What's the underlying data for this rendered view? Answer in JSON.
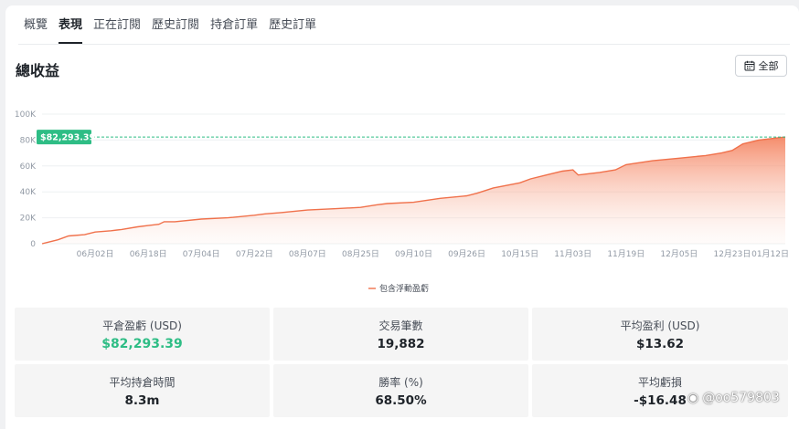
{
  "tabs": [
    {
      "label": "概覽",
      "active": false
    },
    {
      "label": "表現",
      "active": true
    },
    {
      "label": "正在訂閱",
      "active": false
    },
    {
      "label": "歷史訂閱",
      "active": false
    },
    {
      "label": "持倉訂單",
      "active": false
    },
    {
      "label": "歷史訂單",
      "active": false
    }
  ],
  "section": {
    "title": "總收益",
    "range_label": "全部"
  },
  "colors": {
    "line": "#f0714b",
    "fill_top": "#f4805c",
    "badge": "#2ebd85",
    "reference_line": "#2ebd85",
    "green_value": "#2ebd85"
  },
  "chart_data": {
    "type": "area",
    "title": "",
    "xlabel": "",
    "ylabel": "",
    "ylim": [
      0,
      100000
    ],
    "y_ticks": [
      0,
      20000,
      40000,
      60000,
      80000,
      100000
    ],
    "y_tick_labels": [
      "0",
      "20K",
      "40K",
      "60K",
      "80K",
      "100K"
    ],
    "x_tick_labels": [
      "06月02日",
      "06月18日",
      "07月04日",
      "07月22日",
      "08月07日",
      "08月25日",
      "09月10日",
      "09月26日",
      "10月15日",
      "11月03日",
      "11月19日",
      "12月05日",
      "12月23日",
      "01月12日"
    ],
    "x_tick_positions": [
      1.0,
      2.0,
      3.0,
      4.0,
      5.0,
      6.0,
      7.0,
      8.0,
      9.0,
      10.0,
      11.0,
      12.0,
      13.0,
      14.0
    ],
    "grid": true,
    "legend_position": "bottom-center",
    "series": [
      {
        "name": "包含浮動盈虧",
        "x": [
          0.0,
          0.1,
          0.3,
          0.5,
          0.8,
          1.0,
          1.3,
          1.5,
          1.8,
          2.0,
          2.2,
          2.3,
          2.5,
          3.0,
          3.5,
          4.0,
          4.2,
          4.5,
          5.0,
          5.5,
          6.0,
          6.3,
          6.5,
          7.0,
          7.5,
          8.0,
          8.2,
          8.5,
          9.0,
          9.2,
          9.5,
          9.8,
          10.0,
          10.1,
          10.3,
          10.5,
          10.8,
          11.0,
          11.5,
          12.0,
          12.5,
          12.8,
          13.0,
          13.2,
          13.5,
          14.0
        ],
        "y": [
          0,
          1000,
          3000,
          6000,
          7000,
          9000,
          10000,
          11000,
          13000,
          14000,
          15000,
          17000,
          17000,
          19000,
          20000,
          22000,
          23000,
          24000,
          26000,
          27000,
          28000,
          30000,
          31000,
          32000,
          35000,
          37000,
          39000,
          43000,
          47000,
          50000,
          53000,
          56000,
          57000,
          53000,
          54000,
          55000,
          57000,
          61000,
          64000,
          66000,
          68000,
          70000,
          72000,
          77000,
          80000,
          82293
        ]
      }
    ],
    "reference_line": {
      "value": 82293.39,
      "label": "$82,293.39",
      "style": "dashed"
    }
  },
  "stats": [
    {
      "label": "平倉盈虧 (USD)",
      "value": "$82,293.39",
      "highlight": true
    },
    {
      "label": "交易筆數",
      "value": "19,882",
      "highlight": false
    },
    {
      "label": "平均盈利 (USD)",
      "value": "$13.62",
      "highlight": false
    },
    {
      "label": "平均持倉時間",
      "value": "8.3m",
      "highlight": false
    },
    {
      "label": "勝率 (%)",
      "value": "68.50%",
      "highlight": false
    },
    {
      "label": "平均虧損",
      "value": "-$16.48",
      "highlight": false
    }
  ],
  "watermark": {
    "text": "@oo579803"
  }
}
